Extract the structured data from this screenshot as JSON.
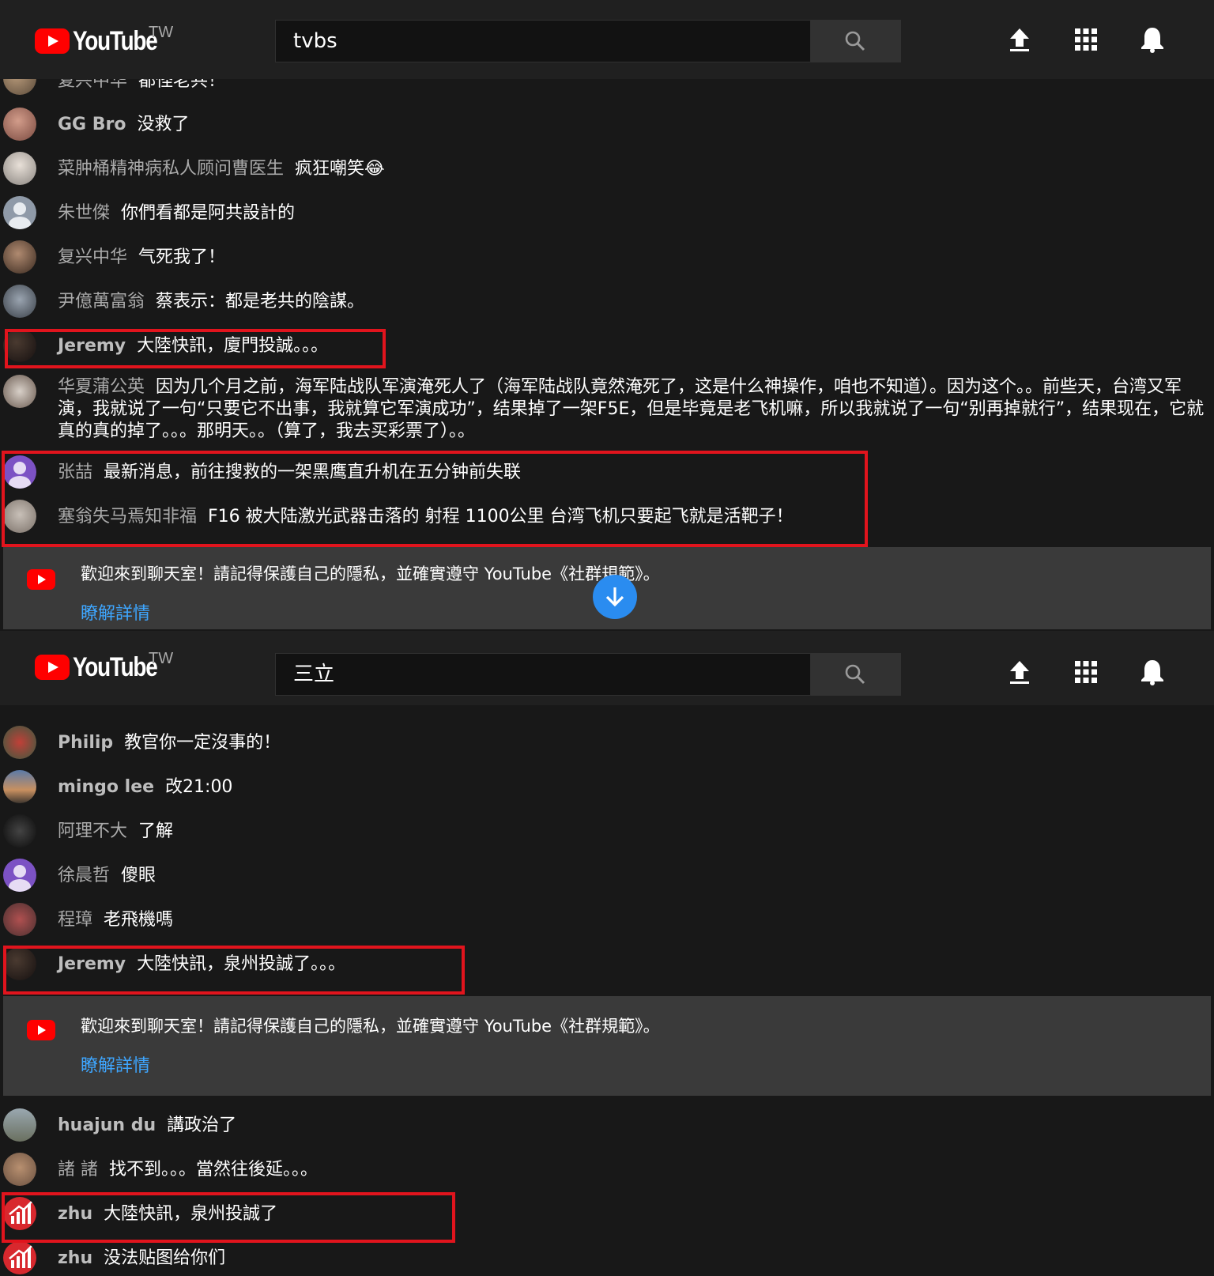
{
  "top_screen": {
    "logo": {
      "wordmark": "YouTube",
      "region": "TW"
    },
    "search": {
      "value": "tvbs"
    },
    "messages": [
      {
        "author": "复兴中华",
        "text": "都怪老共！"
      },
      {
        "author": "GG Bro",
        "text": "没救了"
      },
      {
        "author": "菜肿桶精神病私人顾问曹医生",
        "text": "疯狂嘲笑😂"
      },
      {
        "author": "朱世傑",
        "text": "你們看都是阿共設計的"
      },
      {
        "author": "复兴中华",
        "text": "气死我了！"
      },
      {
        "author": "尹億萬富翁",
        "text": "蔡表示：都是老共的陰謀。"
      },
      {
        "author": "Jeremy",
        "text": "大陸快訊，廈門投誠。。。"
      },
      {
        "author": "华夏蒲公英",
        "text": "因为几个月之前，海军陆战队军演淹死人了（海军陆战队竟然淹死了，这是什么神操作，咱也不知道）。因为这个。。前些天，台湾又军演，我就说了一句“只要它不出事，我就算它军演成功”，结果掉了一架F5E，但是毕竟是老飞机嘛，所以我就说了一句“别再掉就行”，结果现在，它就真的真的掉了。。。那明天。。（算了，我去买彩票了）。。"
      },
      {
        "author": "张喆",
        "text": "最新消息，前往搜救的一架黑鹰直升机在五分钟前失联"
      },
      {
        "author": "塞翁失马焉知非福",
        "text": "F16 被大陆激光武器击落的 射程 1100公里 台湾飞机只要起飞就是活靶子！"
      }
    ],
    "banner": {
      "text": "歡迎來到聊天室！請記得保護自己的隱私，並確實遵守 YouTube《社群規範》。",
      "link": "瞭解詳情"
    }
  },
  "bottom_screen": {
    "logo": {
      "wordmark": "YouTube",
      "region": "TW"
    },
    "search": {
      "value": "三立"
    },
    "messages": [
      {
        "author": "Philip",
        "text": "教官你一定沒事的！"
      },
      {
        "author": "mingo lee",
        "text": "改21:00"
      },
      {
        "author": "阿理不大",
        "text": "了解"
      },
      {
        "author": "徐晨哲",
        "text": "傻眼"
      },
      {
        "author": "程璋",
        "text": "老飛機嗎"
      },
      {
        "author": "Jeremy",
        "text": "大陸快訊，泉州投誠了。。。"
      }
    ],
    "banner": {
      "text": "歡迎來到聊天室！請記得保護自己的隱私，並確實遵守 YouTube《社群規範》。",
      "link": "瞭解詳情"
    },
    "messages_after": [
      {
        "author": "huajun du",
        "text": "講政治了"
      },
      {
        "author": "諸 諸",
        "text": "找不到。。。當然往後延。。。"
      },
      {
        "author": "zhu",
        "text": "大陸快訊，泉州投誠了"
      },
      {
        "author": "zhu",
        "text": "没法贴图给你们"
      }
    ]
  },
  "colors": {
    "highlight_box": "#e1141d",
    "brand_red": "#ff0000",
    "link_blue": "#3ea6ff",
    "scroll_button": "#2a8cf0"
  },
  "icons": [
    "search-icon",
    "upload-icon",
    "apps-grid-icon",
    "notifications-bell-icon",
    "scroll-down-arrow-icon",
    "youtube-logo-icon"
  ]
}
